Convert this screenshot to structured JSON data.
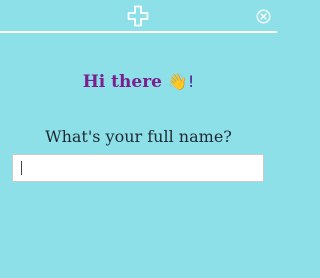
{
  "header": {
    "logo_icon": "plus-cross-outline-icon",
    "close_icon": "circle-x-icon"
  },
  "main": {
    "greeting": "Hi there",
    "greeting_emoji": "👋!",
    "question": "What's your full name?",
    "name_input": {
      "value": "",
      "placeholder": ""
    }
  },
  "colors": {
    "background": "#8ddfe8",
    "greeting": "#7b1e8e",
    "question": "#1e2a31",
    "rule": "#ffffff"
  }
}
